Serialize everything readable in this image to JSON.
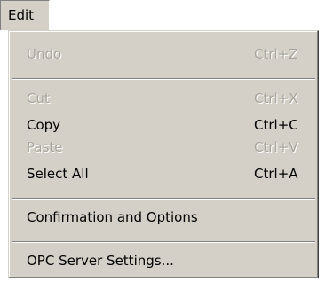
{
  "menubar": {
    "title": "Edit"
  },
  "menu": {
    "items": [
      {
        "label": "Undo",
        "shortcut": "Ctrl+Z",
        "enabled": false
      },
      {
        "label": "Cut",
        "shortcut": "Ctrl+X",
        "enabled": false
      },
      {
        "label": "Copy",
        "shortcut": "Ctrl+C",
        "enabled": true
      },
      {
        "label": "Paste",
        "shortcut": "Ctrl+V",
        "enabled": false
      },
      {
        "label": "Select All",
        "shortcut": "Ctrl+A",
        "enabled": true
      },
      {
        "label": "Confirmation and Options",
        "shortcut": "",
        "enabled": true
      },
      {
        "label": "OPC Server Settings...",
        "shortcut": "",
        "enabled": true
      }
    ]
  },
  "colors": {
    "menu_face": "#d4d0c8",
    "disabled_text": "#a9a59d",
    "enabled_text": "#000000"
  }
}
